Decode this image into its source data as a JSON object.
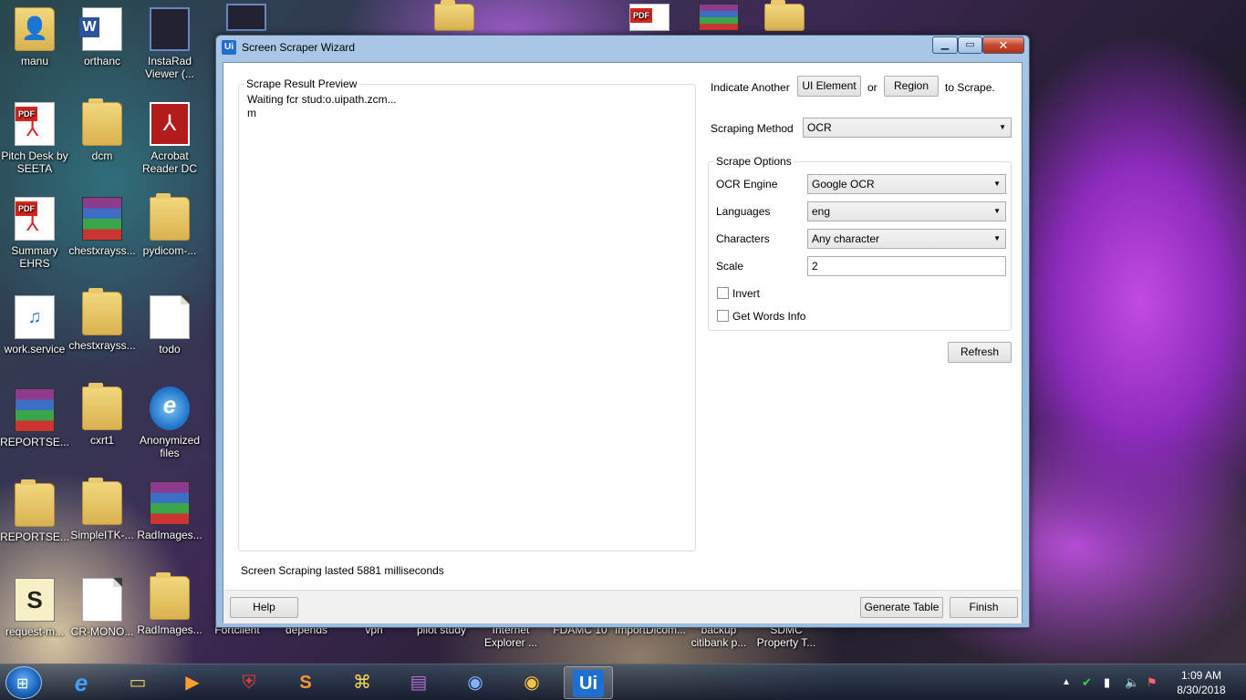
{
  "desktop": {
    "icons": [
      {
        "label": "manu",
        "icon": "user-folder-icon"
      },
      {
        "label": "orthanc",
        "icon": "word-document-icon"
      },
      {
        "label": "InstaRad Viewer (...",
        "icon": "app-shortcut-icon"
      },
      {
        "label": "Pitch Desk by SEETA",
        "icon": "pdf-icon"
      },
      {
        "label": "dcm",
        "icon": "folder-icon"
      },
      {
        "label": "Acrobat Reader DC",
        "icon": "acrobat-icon"
      },
      {
        "label": "Summary EHRS",
        "icon": "pdf-icon"
      },
      {
        "label": "chestxrayss...",
        "icon": "winrar-icon"
      },
      {
        "label": "pydicom-...",
        "icon": "folder-icon"
      },
      {
        "label": "work.service",
        "icon": "media-file-icon"
      },
      {
        "label": "chestxrayss...",
        "icon": "folder-icon"
      },
      {
        "label": "todo",
        "icon": "text-file-icon"
      },
      {
        "label": "REPORTSE...",
        "icon": "winrar-icon"
      },
      {
        "label": "cxrt1",
        "icon": "folder-icon"
      },
      {
        "label": "Anonymized files",
        "icon": "ie-icon"
      },
      {
        "label": "REPORTSE...",
        "icon": "folder-icon"
      },
      {
        "label": "SimpleITK-...",
        "icon": "folder-icon"
      },
      {
        "label": "RadImages...",
        "icon": "winrar-icon"
      },
      {
        "label": "request-m...",
        "icon": "script-icon"
      },
      {
        "label": "CR-MONO...",
        "icon": "text-file-icon"
      },
      {
        "label": "RadImages...",
        "icon": "folder-icon"
      }
    ],
    "behind_labels": [
      "Fortclient",
      "depends",
      "vpn",
      "pilot study",
      "Internet Explorer ...",
      "FDAMC 10",
      "ImportDicom...",
      "backup citibank p...",
      "SDMC Property T..."
    ]
  },
  "window": {
    "title": "Screen Scraper Wizard",
    "app_badge": "Ui",
    "preview": {
      "group_label": "Scrape Result Preview",
      "text": "Waiting fcr stud:o.uipath.zcm...\nm",
      "status": "Screen Scraping lasted 5881 milliseconds"
    },
    "indicate": {
      "prefix": "Indicate Another",
      "ui_element_button": "UI Element",
      "or_text": "or",
      "region_button": "Region",
      "suffix": "to Scrape."
    },
    "method": {
      "label": "Scraping Method",
      "value": "OCR"
    },
    "options": {
      "group_label": "Scrape Options",
      "ocr_engine_label": "OCR Engine",
      "ocr_engine_value": "Google OCR",
      "languages_label": "Languages",
      "languages_value": "eng",
      "characters_label": "Characters",
      "characters_value": "Any character",
      "scale_label": "Scale",
      "scale_value": "2",
      "invert_label": "Invert",
      "invert_checked": false,
      "words_info_label": "Get Words Info",
      "words_info_checked": false
    },
    "refresh_button": "Refresh",
    "help_button": "Help",
    "generate_table_button": "Generate Table",
    "finish_button": "Finish"
  },
  "taskbar": {
    "items": [
      "start-orb",
      "internet-explorer-icon",
      "file-explorer-icon",
      "media-player-icon",
      "security-shield-icon",
      "sublime-text-icon",
      "python-icon",
      "winrar-icon",
      "chromium-icon",
      "chrome-icon",
      "uipath-icon"
    ],
    "active": "uipath-icon",
    "uipath_label": "Ui",
    "clock_time": "1:09 AM",
    "clock_date": "8/30/2018"
  }
}
